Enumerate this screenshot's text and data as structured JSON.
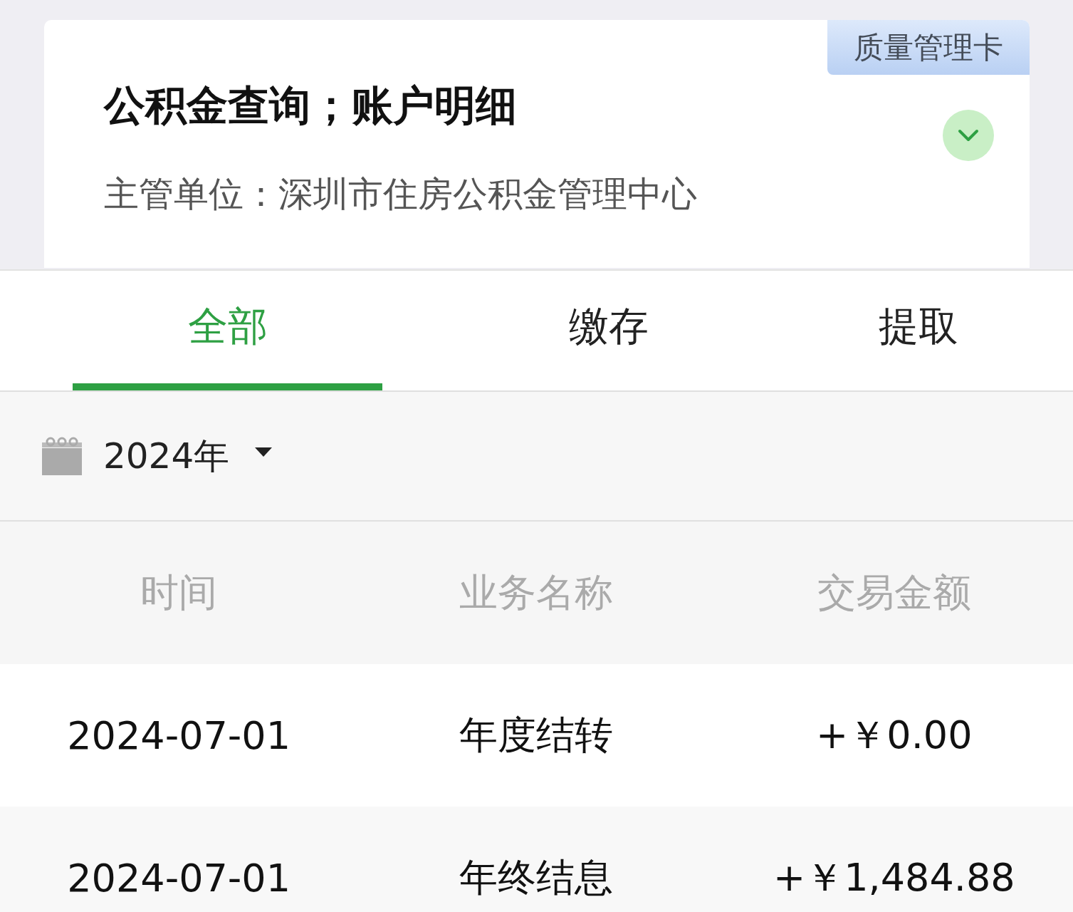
{
  "card": {
    "tag": "质量管理卡",
    "title": "公积金查询；账户明细",
    "subtitle": "主管单位：深圳市住房公积金管理中心",
    "expanded": false
  },
  "tabs": [
    {
      "label": "全部",
      "selected": true
    },
    {
      "label": "缴存",
      "selected": false
    },
    {
      "label": "提取",
      "selected": false
    }
  ],
  "year_filter": {
    "value": "2024年"
  },
  "table": {
    "columns": [
      "时间",
      "业务名称",
      "交易金额"
    ],
    "rows": [
      [
        "2024-07-01",
        "年度结转",
        "+￥0.00"
      ],
      [
        "2024-07-01",
        "年终结息",
        "+￥1,484.88"
      ]
    ]
  }
}
